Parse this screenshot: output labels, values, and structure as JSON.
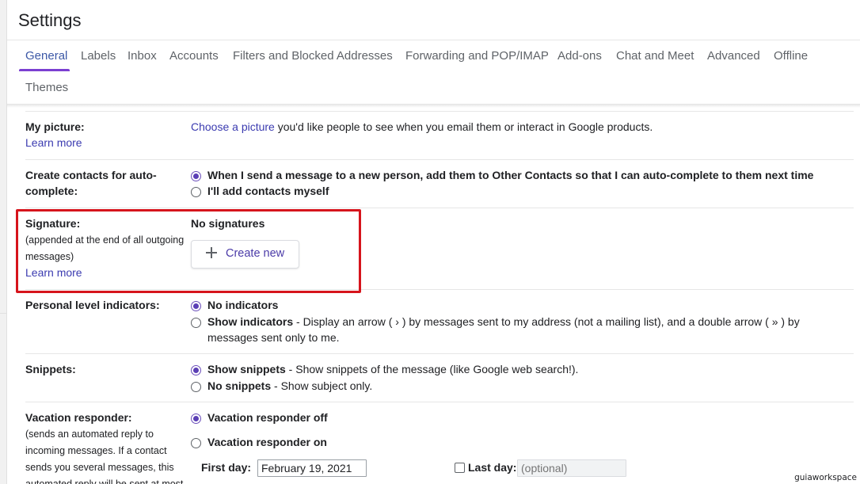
{
  "header": {
    "title": "Settings"
  },
  "tabs": [
    {
      "label": "General"
    },
    {
      "label": "Labels"
    },
    {
      "label": "Inbox"
    },
    {
      "label": "Accounts"
    },
    {
      "label": "Filters and Blocked Addresses"
    },
    {
      "label": "Forwarding and POP/IMAP"
    },
    {
      "label": "Add-ons"
    },
    {
      "label": "Chat and Meet"
    },
    {
      "label": "Advanced"
    },
    {
      "label": "Offline"
    },
    {
      "label": "Themes"
    }
  ],
  "my_picture": {
    "label": "My picture:",
    "learn_more": "Learn more",
    "link": "Choose a picture",
    "text": " you'd like people to see when you email them or interact in Google products."
  },
  "contacts": {
    "label_line1": "Create contacts for auto-",
    "label_line2": "complete:",
    "option1": "When I send a message to a new person, add them to Other Contacts so that I can auto-complete to them next time",
    "option2": "I'll add contacts myself"
  },
  "signature": {
    "label": "Signature:",
    "sub_line1": "(appended at the end of all outgoing",
    "sub_line2": "messages)",
    "learn_more": "Learn more",
    "status": "No signatures",
    "create_button": "Create new"
  },
  "indicators": {
    "label": "Personal level indicators:",
    "option1": "No indicators",
    "option2_bold": "Show indicators",
    "option2_text": " - Display an arrow ( › ) by messages sent to my address (not a mailing list), and a double arrow ( » ) by",
    "option2_line2": "messages sent only to me."
  },
  "snippets": {
    "label": "Snippets:",
    "option1_bold": "Show snippets",
    "option1_text": " - Show snippets of the message (like Google web search!).",
    "option2_bold": "No snippets",
    "option2_text": " - Show subject only."
  },
  "vacation": {
    "label": "Vacation responder:",
    "sub_line1": "(sends an automated reply to",
    "sub_line2": "incoming messages. If a contact",
    "sub_line3": "sends you several messages, this",
    "sub_line4": "automated reply will be sent at most",
    "option_off": "Vacation responder off",
    "option_on": "Vacation responder on",
    "first_day_label": "First day:",
    "first_day_value": "February 19, 2021",
    "last_day_label": "Last day:",
    "last_day_placeholder": "(optional)"
  },
  "watermark": "guiaworkspace",
  "colors": {
    "accent": "#5b3fb5",
    "link": "#3b3bb0",
    "highlight": "#d6141c"
  }
}
